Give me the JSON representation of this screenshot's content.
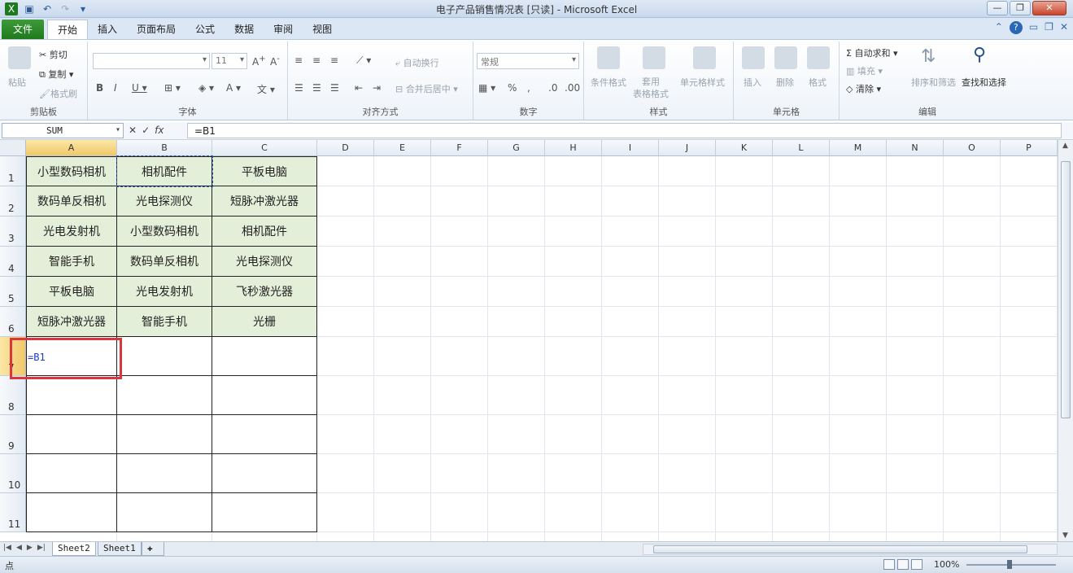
{
  "window": {
    "title": "电子产品销售情况表  [只读]  -  Microsoft Excel"
  },
  "ribbon": {
    "file_tab": "文件",
    "tabs": [
      "开始",
      "插入",
      "页面布局",
      "公式",
      "数据",
      "审阅",
      "视图"
    ],
    "clipboard": {
      "paste": "粘贴",
      "cut": "剪切",
      "copy": "复制",
      "format_painter": "格式刷",
      "label": "剪贴板"
    },
    "font": {
      "font_name": "",
      "font_size": "11",
      "label": "字体"
    },
    "alignment": {
      "wrap": "自动换行",
      "merge": "合并后居中",
      "label": "对齐方式"
    },
    "number": {
      "format": "常规",
      "label": "数字"
    },
    "styles": {
      "conditional": "条件格式",
      "table": "套用\n表格格式",
      "cell_style": "单元格样式",
      "label": "样式"
    },
    "cells": {
      "insert": "插入",
      "delete": "删除",
      "format": "格式",
      "label": "单元格"
    },
    "editing": {
      "autosum": "自动求和",
      "fill": "填充",
      "clear": "清除",
      "sort": "排序和筛选",
      "find": "查找和选择",
      "label": "编辑"
    }
  },
  "formula_bar": {
    "name_box": "SUM",
    "formula": "=B1"
  },
  "grid": {
    "columns": [
      "A",
      "B",
      "C",
      "D",
      "E",
      "F",
      "G",
      "H",
      "I",
      "J",
      "K",
      "L",
      "M",
      "N",
      "O",
      "P"
    ],
    "rows": [
      "1",
      "2",
      "3",
      "4",
      "5",
      "6",
      "7",
      "8",
      "9",
      "10",
      "11"
    ],
    "data": [
      [
        "小型数码相机",
        "相机配件",
        "平板电脑"
      ],
      [
        "数码单反相机",
        "光电探测仪",
        "短脉冲激光器"
      ],
      [
        "光电发射机",
        "小型数码相机",
        "相机配件"
      ],
      [
        "智能手机",
        "数码单反相机",
        "光电探测仪"
      ],
      [
        "平板电脑",
        "光电发射机",
        "飞秒激光器"
      ],
      [
        "短脉冲激光器",
        "智能手机",
        "光栅"
      ]
    ],
    "editing_cell_text": "=B1",
    "selected_column": "A",
    "selected_row": "7"
  },
  "sheets": [
    "Sheet2",
    "Sheet1"
  ],
  "status": {
    "mode": "点",
    "zoom": "100%"
  }
}
